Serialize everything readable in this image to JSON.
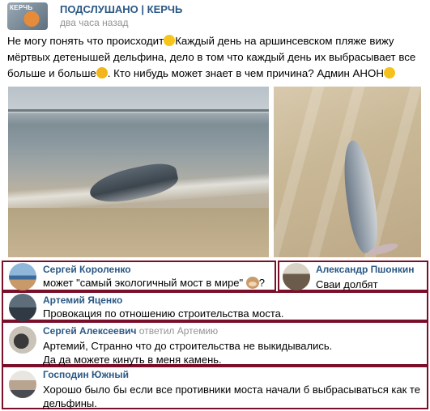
{
  "post": {
    "group_name": "ПОДСЛУШАНО | КЕРЧЬ",
    "avatar_text": "КЕРЧЬ",
    "time": "два часа назад",
    "text_part1": "Не могу понять что происходит",
    "text_part2": "Каждый день на аршинсевском пляже вижу мёртвых детенышей дельфина, дело в том что каждый день их выбрасывает все больше и больше",
    "text_part3": ". Кто нибудь может знает в чем причина? Админ АНОН",
    "photos": [
      "dolphin-on-shore-photo",
      "dolphin-on-sand-photo"
    ]
  },
  "comments": [
    {
      "author": "Сергей Короленко",
      "text": "может \"самый экологичный мост в мире\"",
      "text_suffix": "?"
    },
    {
      "author": "Александр Пшонкин",
      "text": "Сваи долбят"
    },
    {
      "author": "Артемий Яценко",
      "text": "Провокация по отношению строительства моста."
    },
    {
      "author": "Сергей Алексеевич",
      "reply_to": "ответил Артемию",
      "text_line1": "Артемий, Странно что до строительства не выкидывались.",
      "text_line2": "Да да можете кинуть в меня  камень."
    },
    {
      "author": "Господин Южный",
      "text_line1": "Хорошо было бы если все противники моста начали б выбрасываться как те",
      "text_line2": "дельфины."
    }
  ],
  "colors": {
    "link": "#2a5885",
    "border": "#7a0f2a",
    "muted": "#939393"
  }
}
